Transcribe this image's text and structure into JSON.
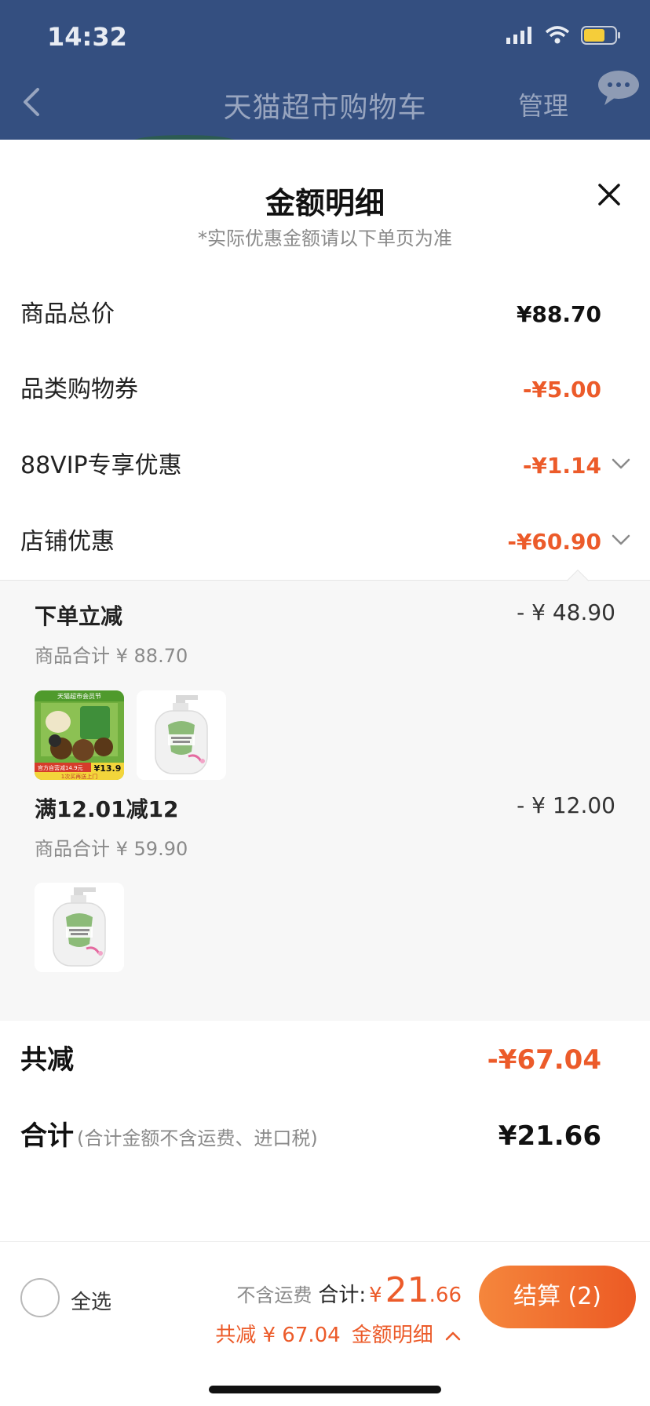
{
  "status_bar": {
    "time": "14:32"
  },
  "nav": {
    "title": "天猫超市购物车",
    "manage_label": "管理"
  },
  "sheet": {
    "title": "金额明细",
    "subtitle": "*实际优惠金额请以下单页为准",
    "rows": [
      {
        "label": "商品总价",
        "amount": "¥88.70",
        "style": "black",
        "expandable": false
      },
      {
        "label": "品类购物券",
        "amount": "-¥5.00",
        "style": "orange",
        "expandable": false
      },
      {
        "label": "88VIP专享优惠",
        "amount": "-¥1.14",
        "style": "orange",
        "expandable": true
      },
      {
        "label": "店铺优惠",
        "amount": "-¥60.90",
        "style": "orange",
        "expandable": true,
        "expanded": true
      }
    ],
    "shop_discount_details": [
      {
        "name": "下单立减",
        "amount": "- ¥ 48.90",
        "subtotal": "商品合计 ¥ 88.70",
        "products": [
          {
            "name": "thumb-snack-pack",
            "badge": "天猫超市会员节",
            "price_tag": "¥13.9",
            "promo_text": "官方自营减14.9元",
            "delivery_text": "1次买再送上门"
          },
          {
            "name": "thumb-hand-soap"
          }
        ]
      },
      {
        "name": "满12.01减12",
        "amount": "- ¥ 12.00",
        "subtotal": "商品合计 ¥ 59.90",
        "products": [
          {
            "name": "thumb-hand-soap"
          }
        ]
      }
    ],
    "total_discount": {
      "label": "共减",
      "amount": "-¥67.04"
    },
    "grand_total": {
      "label": "合计",
      "note": "(合计金额不含运费、进口税)",
      "amount": "¥21.66"
    }
  },
  "bottom_bar": {
    "select_all_label": "全选",
    "shipping_note": "不含运费",
    "sum_label": "合计:",
    "currency": "¥",
    "sum_integer": "21",
    "sum_decimal": ".66",
    "discount_line": "共减 ¥ 67.04",
    "detail_toggle_label": "金额明细",
    "checkout_label": "结算 (2)"
  },
  "colors": {
    "header_bg": "#344f80",
    "accent_orange": "#ec5b2a",
    "panel_bg": "#f7f7f7"
  },
  "icons": [
    "back-chevron-icon",
    "message-bubble-icon",
    "close-icon",
    "chevron-down-icon",
    "chevron-up-icon",
    "signal-icon",
    "wifi-icon",
    "battery-icon"
  ]
}
